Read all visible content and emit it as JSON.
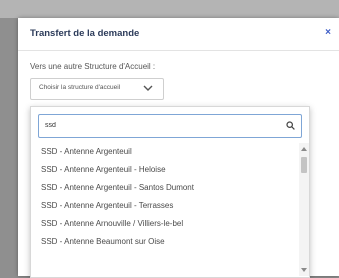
{
  "modal": {
    "title": "Transfert de la demande",
    "close_glyph": "×",
    "subtitle": "Vers une autre Structure d'Accueil :",
    "select": {
      "value": "Choisir la structure d'accueil",
      "icon": "chevron-down-icon"
    }
  },
  "dropdown": {
    "search": {
      "value": "ssd",
      "icon": "search-icon"
    },
    "options": [
      "SSD - Antenne Argenteuil",
      "SSD - Antenne Argenteuil - Heloise",
      "SSD - Antenne Argenteuil - Santos Dumont",
      "SSD - Antenne Argenteuil - Terrasses",
      "SSD - Antenne Arnouville / Villiers-le-bel",
      "SSD - Antenne Beaumont sur Oise"
    ]
  },
  "colors": {
    "title": "#2c3b5a",
    "close": "#3b5bc6",
    "search_border": "#7fa6d6",
    "backdrop": "#8f8f8f"
  }
}
